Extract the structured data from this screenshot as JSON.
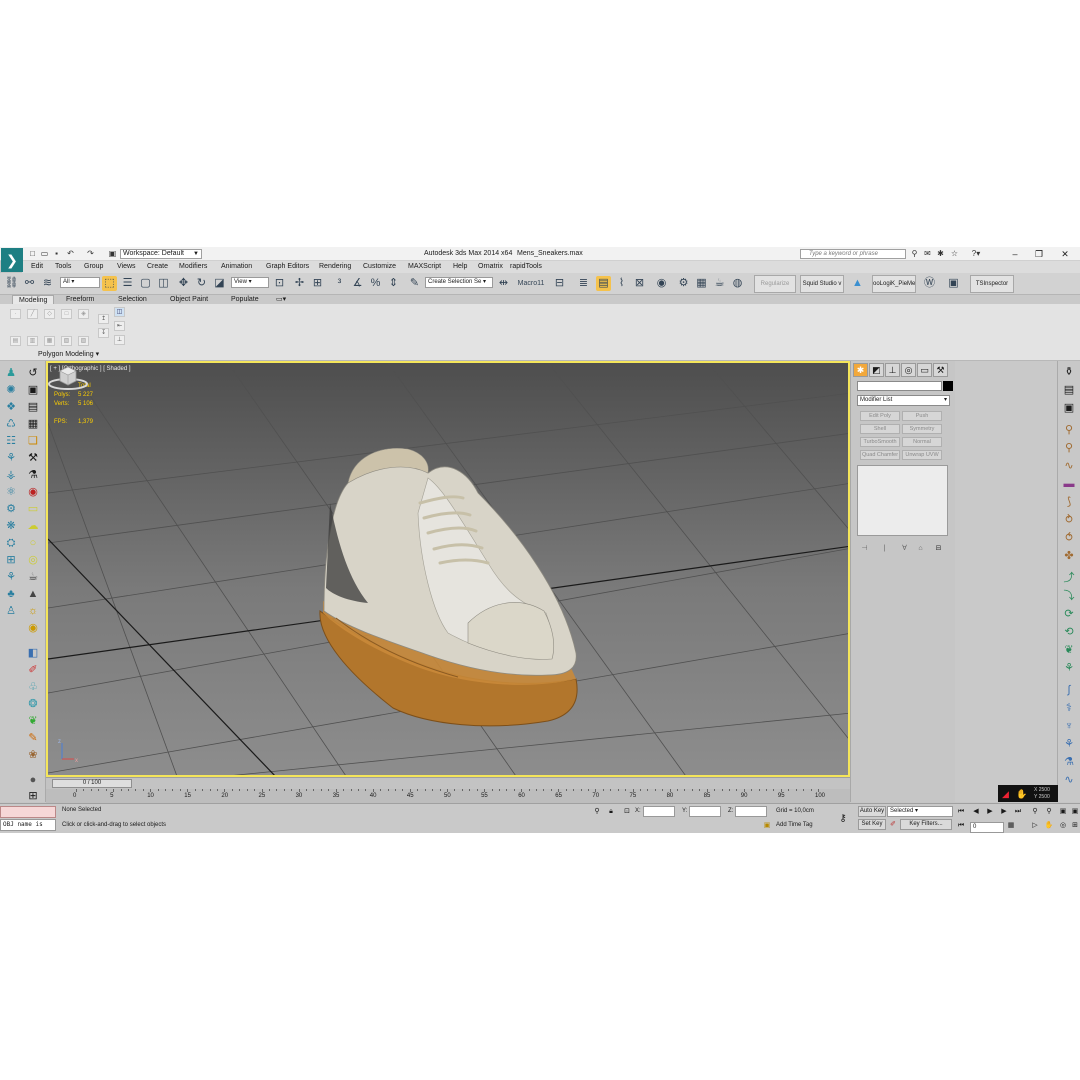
{
  "window": {
    "app_title": "Autodesk 3ds Max  2014 x64",
    "file_name": "Mens_Sneakers.max",
    "workspace": "Workspace: Default",
    "help_search_placeholder": "Type a keyword or phrase"
  },
  "menu": [
    "Edit",
    "Tools",
    "Group",
    "Views",
    "Create",
    "Modifiers",
    "Animation",
    "Graph Editors",
    "Rendering",
    "Customize",
    "MAXScript",
    "Help",
    "Ornatrix",
    "rapidTools"
  ],
  "toolbar": {
    "selection_filter": "All",
    "reference_coord": "View",
    "named_selection": "Create Selection Se",
    "macro_label": "Macro11",
    "regularize": "Regularize",
    "squid_studio": "Squid Studio v",
    "pie_menu": "ooLogiK_PieMe",
    "ts_inspector": "TSInspector"
  },
  "ribbon": {
    "tabs": [
      "Modeling",
      "Freeform",
      "Selection",
      "Object Paint",
      "Populate"
    ],
    "active_tab": "Modeling",
    "group_label": "Polygon Modeling"
  },
  "viewport": {
    "label": "[ + ] [Orthographic ] [ Shaded ]",
    "stats": {
      "total_label": "Total",
      "polys_label": "Polys:",
      "polys_value": "5 227",
      "verts_label": "Verts:",
      "verts_value": "5 106",
      "fps_label": "FPS:",
      "fps_value": "1,379"
    }
  },
  "command_panel": {
    "modifier_list": "Modifier List",
    "modifier_buttons": [
      "Edit Poly",
      "Push",
      "Shell",
      "Symmetry",
      "TurboSmooth",
      "Normal",
      "Quad Chamfer",
      "Unwrap UVW"
    ]
  },
  "timeline": {
    "slider": "0 / 100",
    "ticks": [
      "0",
      "5",
      "10",
      "15",
      "20",
      "25",
      "30",
      "35",
      "40",
      "45",
      "50",
      "55",
      "60",
      "65",
      "70",
      "75",
      "80",
      "85",
      "90",
      "95",
      "100"
    ]
  },
  "status": {
    "maxscript_input": "OBJ name is",
    "selection": "None Selected",
    "prompt": "Click or click-and-drag to select objects",
    "x_label": "X:",
    "y_label": "Y:",
    "z_label": "Z:",
    "grid": "Grid = 10,0cm",
    "add_time_tag": "Add Time Tag",
    "auto_key": "Auto Key",
    "set_key": "Set Key",
    "key_mode": "Selected",
    "key_filters": "Key Filters...",
    "current_frame": "0"
  },
  "nav_readout": {
    "x": "X 2500",
    "y": "Y 2500"
  },
  "colors": {
    "viewport_border": "#f4e55a",
    "stats_text": "#ffd000",
    "active_tab": "#f2a83b",
    "app_accent": "#1e7f83"
  }
}
